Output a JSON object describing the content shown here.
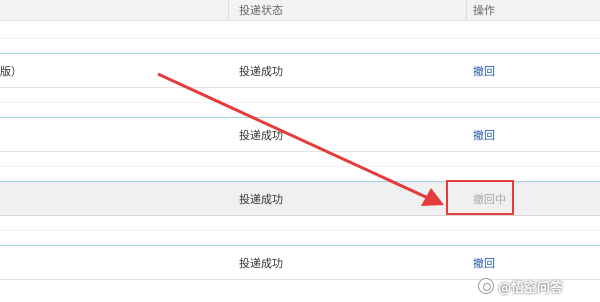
{
  "header": {
    "columns": [
      "投递状态",
      "操作"
    ]
  },
  "rows": [
    {
      "name_fragment": "版）",
      "status": "投递成功",
      "action": "撤回",
      "selected": false
    },
    {
      "name_fragment": "",
      "status": "投递成功",
      "action": "撤回",
      "selected": false
    },
    {
      "name_fragment": "",
      "status": "投递成功",
      "action": "撤回中",
      "selected": true
    },
    {
      "name_fragment": "",
      "status": "投递成功",
      "action": "撤回",
      "selected": false
    }
  ],
  "annotation": {
    "arrow_color": "#e53b3b",
    "box_color": "#e53b3b"
  },
  "watermark": {
    "text": "@悟空问答"
  },
  "colors": {
    "link": "#2b5ba5",
    "pending": "#aaaaaa",
    "row_border": "#9fd3e6"
  }
}
